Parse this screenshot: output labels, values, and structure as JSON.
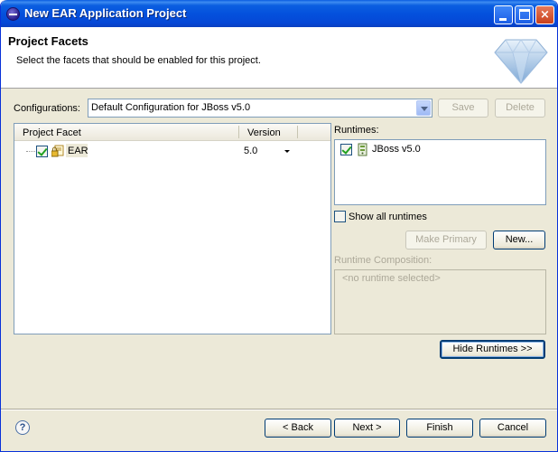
{
  "window": {
    "title": "New EAR Application Project",
    "controls": {
      "minimize": "minimize",
      "maximize": "maximize",
      "close": "×"
    }
  },
  "header": {
    "title": "Project Facets",
    "description": "Select the facets that should be enabled for this project."
  },
  "configurations": {
    "label": "Configurations:",
    "value": "Default Configuration for JBoss v5.0",
    "save_label": "Save",
    "delete_label": "Delete"
  },
  "facets_table": {
    "columns": [
      "Project Facet",
      "Version"
    ],
    "rows": [
      {
        "facet": "EAR",
        "version": "5.0",
        "checked": true
      }
    ]
  },
  "runtimes": {
    "label": "Runtimes:",
    "items": [
      {
        "name": "JBoss v5.0",
        "checked": true
      }
    ],
    "show_all_label": "Show all runtimes",
    "make_primary_label": "Make Primary",
    "new_label": "New...",
    "composition_label": "Runtime Composition:",
    "composition_empty": "<no runtime selected>",
    "hide_runtimes_label": "Hide Runtimes >>"
  },
  "footer": {
    "help": "?",
    "back_label": "< Back",
    "next_label": "Next >",
    "finish_label": "Finish",
    "cancel_label": "Cancel"
  },
  "colors": {
    "titlebar": "#0451dd",
    "dialog_bg": "#ece9d8",
    "button_border": "#003c74",
    "disabled_text": "#aca899"
  }
}
